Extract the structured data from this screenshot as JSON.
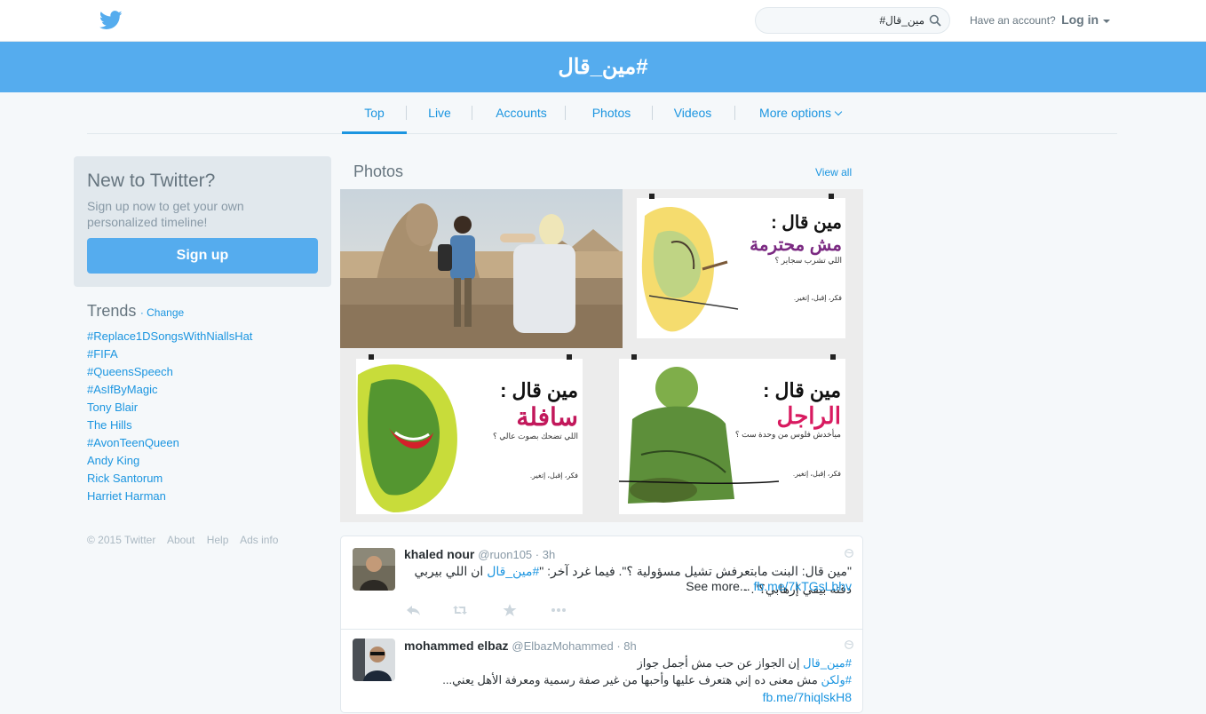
{
  "header": {
    "search_value": "#مين_قال",
    "account_prompt": "Have an account?",
    "login_label": "Log in"
  },
  "banner": {
    "title": "#مين_قال"
  },
  "nav": {
    "tabs": [
      {
        "label": "Top"
      },
      {
        "label": "Live"
      },
      {
        "label": "Accounts"
      },
      {
        "label": "Photos"
      },
      {
        "label": "Videos"
      },
      {
        "label": "More options"
      }
    ]
  },
  "signup": {
    "title": "New to Twitter?",
    "subtitle": "Sign up now to get your own personalized timeline!",
    "button": "Sign up"
  },
  "trends": {
    "title": "Trends",
    "change": "· Change",
    "items": [
      "#Replace1DSongsWithNiallsHat",
      "#FIFA",
      "#QueensSpeech",
      "#AsIfByMagic",
      "Tony Blair",
      "The Hills",
      "#AvonTeenQueen",
      "Andy King",
      "Rick Santorum",
      "Harriet Harman"
    ]
  },
  "footer": {
    "copyright": "© 2015 Twitter",
    "about": "About",
    "help": "Help",
    "ads": "Ads info"
  },
  "photos": {
    "title": "Photos",
    "view_all": "View all",
    "posters": [
      {
        "heading": "مين قال :",
        "word": "مش محترمة",
        "sub": "اللي تشرب سجاير ؟",
        "foot": "فكر، إقبل، إتغير.",
        "accent": "#7b2a82"
      },
      {
        "heading": "مين قال :",
        "word": "سافلة",
        "sub": "اللي تضحك بصوت عالي ؟",
        "foot": "فكر، إقبل، إتغير.",
        "accent": "#c2185b"
      },
      {
        "heading": "مين قال :",
        "word": "الراجل",
        "sub": "ميأخدش فلوس من وحدة ست ؟",
        "foot": "فكر، إقبل، إتغير.",
        "accent": "#d81b60"
      }
    ]
  },
  "tweets": [
    {
      "name": "khaled nour",
      "handle": "@ruon105 · 3h",
      "line1": "\"مين قال: البنت مابتعرفش تشيل مسؤولية ؟\". فيما غرد آخر: \"",
      "line1_tag": "#مين_قال",
      "line1_rest": " ان اللي بيربي دقنه بيقي إرهابي؟\". -",
      "line2": "See more... ",
      "line2_link": "fb.me/7kTGsLbhv"
    },
    {
      "name": "mohammed elbaz",
      "handle": "@ElbazMohammed · 8h",
      "line1_tag": "#مين_قال",
      "line1_rest": " إن الجواز عن حب مش أجمل جواز",
      "line2_tag": "#ولكن",
      "line2_rest": " مش معنى ده إني هتعرف عليها وأحبها من غير صفة رسمية ومعرفة الأهل يعني...",
      "line3_link": "fb.me/7hiqlskH8"
    }
  ]
}
